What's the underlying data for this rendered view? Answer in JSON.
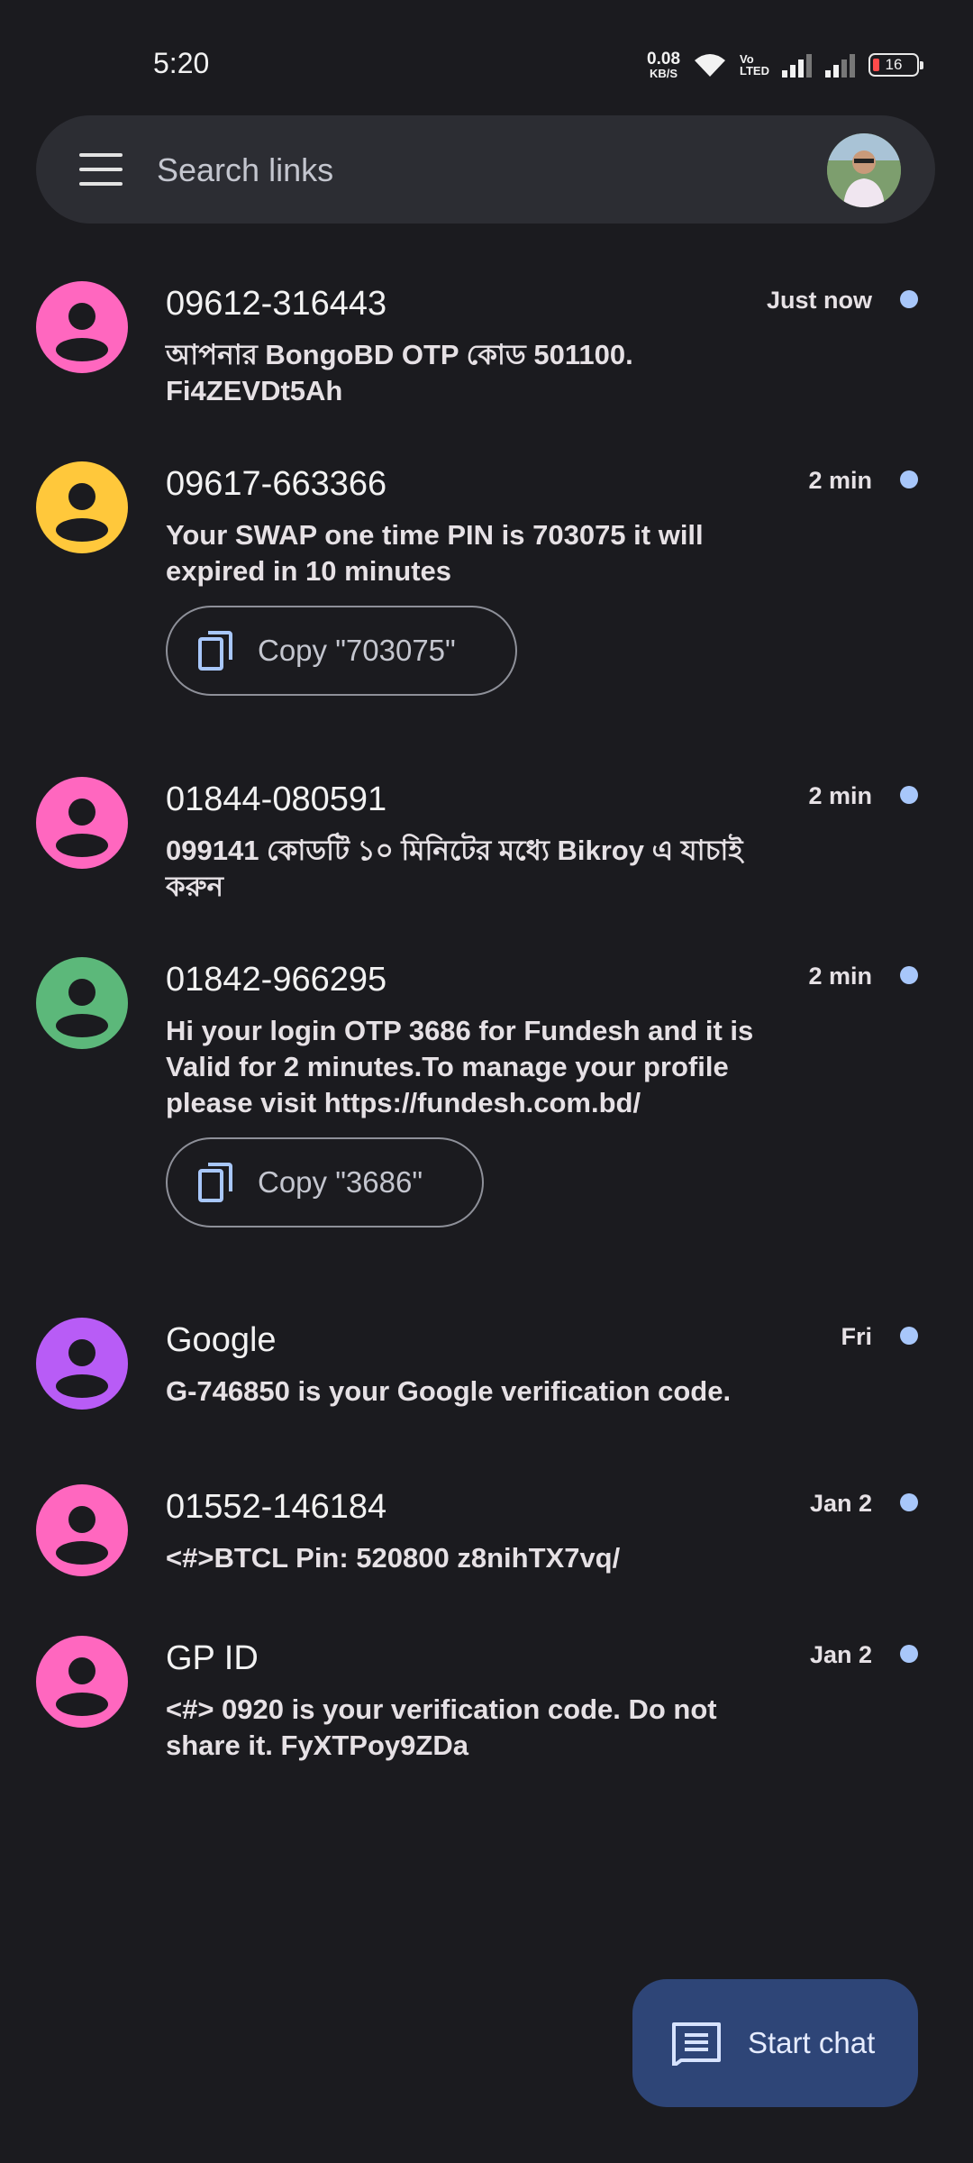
{
  "status_bar": {
    "time": "5:20",
    "speed_value": "0.08",
    "speed_unit": "KB/S",
    "volte_top": "Vo",
    "volte_bottom": "LTED",
    "battery": "16"
  },
  "search": {
    "placeholder": "Search links"
  },
  "colors": {
    "background": "#1b1b1f",
    "search_bg": "#2c2d33",
    "unread_dot": "#a8c7fa",
    "fab_bg": "#2e4577",
    "avatar_pink": "#ff67bf",
    "avatar_yellow": "#ffc83b",
    "avatar_green": "#5cb87a",
    "avatar_purple": "#b85cf6"
  },
  "conversations": [
    {
      "name": "09612-316443",
      "message": "আপনার BongoBD OTP কোড 501100. Fi4ZEVDt5Ah",
      "time": "Just now",
      "avatar_color": "#ff67bf",
      "unread": true
    },
    {
      "name": "09617-663366",
      "message": "Your SWAP one time PIN is 703075 it will expired in 10 minutes",
      "time": "2 min",
      "avatar_color": "#ffc83b",
      "unread": true,
      "copy_label": "Copy \"703075\""
    },
    {
      "name": "01844-080591",
      "message": "099141 কোডটি ১০ মিনিটের মধ্যে Bikroy এ যাচাই করুন",
      "time": "2 min",
      "avatar_color": "#ff67bf",
      "unread": true
    },
    {
      "name": "01842-966295",
      "message": "Hi your login OTP 3686 for Fundesh and it is Valid for 2 minutes.To manage your profile please visit https://fundesh.com.bd/",
      "time": "2 min",
      "avatar_color": "#5cb87a",
      "unread": true,
      "copy_label": "Copy \"3686\""
    },
    {
      "name": "Google",
      "message": "G-746850 is your Google verification code.",
      "time": "Fri",
      "avatar_color": "#b85cf6",
      "unread": true
    },
    {
      "name": "01552-146184",
      "message": "<#>BTCL Pin: 520800 z8nihTX7vq/",
      "time": "Jan 2",
      "avatar_color": "#ff67bf",
      "unread": true
    },
    {
      "name": "GP ID",
      "message": "<#> 0920 is your verification code. Do not share it. FyXTPoy9ZDa",
      "time": "Jan 2",
      "avatar_color": "#ff67bf",
      "unread": true
    }
  ],
  "fab": {
    "label": "Start chat"
  }
}
